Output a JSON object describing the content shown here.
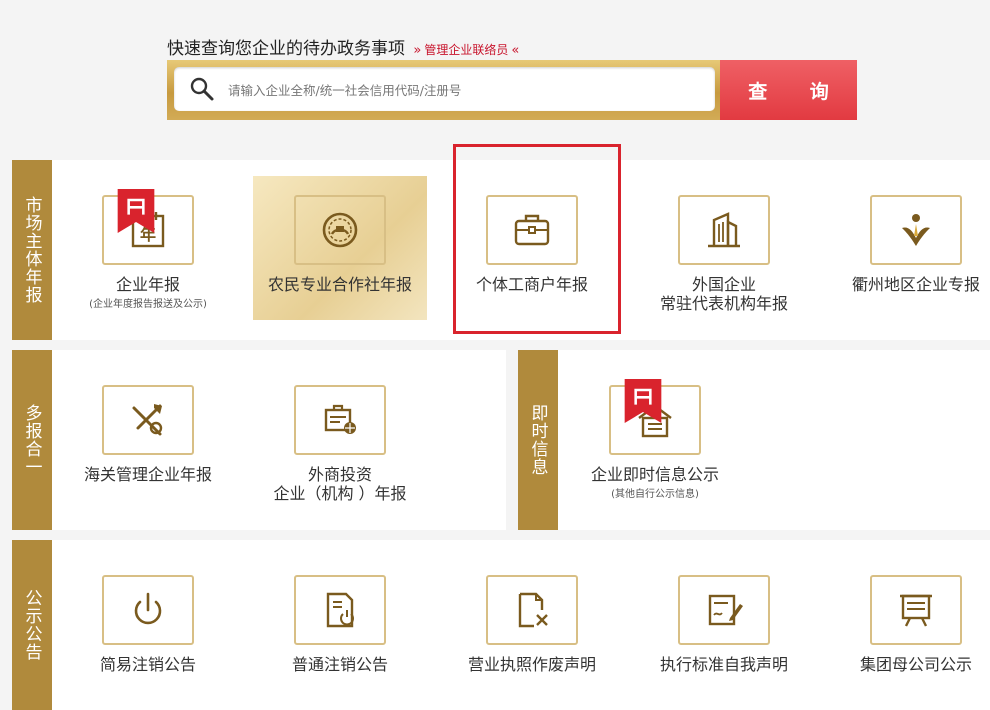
{
  "search": {
    "title": "快速查询您企业的待办政务事项",
    "liaison_link": "管理企业联络员",
    "left_arrows": "»",
    "right_arrows": "«",
    "placeholder": "请输入企业全称/统一社会信用代码/注册号",
    "button_label": "查 询"
  },
  "sections": {
    "market": {
      "label": "市场主体年报",
      "items": [
        {
          "label": "企业年报",
          "sub": "(企业年度报告报送及公示)",
          "icon": "calendar-year-icon"
        },
        {
          "label": "农民专业合作社年报",
          "icon": "cooperative-emblem-icon"
        },
        {
          "label": "个体工商户年报",
          "icon": "briefcase-icon"
        },
        {
          "label": "外国企业",
          "label2": "常驻代表机构年报",
          "icon": "building-icon"
        },
        {
          "label": "衢州地区企业专报",
          "icon": "quzhou-logo-icon"
        }
      ]
    },
    "multi": {
      "label": "多报合一",
      "items": [
        {
          "label": "海关管理企业年报",
          "icon": "customs-emblem-icon"
        },
        {
          "label": "外商投资",
          "label2": "企业（机构 ）年报",
          "icon": "foreign-investment-icon"
        }
      ]
    },
    "instant": {
      "label": "即时信息",
      "items": [
        {
          "label": "企业即时信息公示",
          "sub": "(其他自行公示信息)",
          "icon": "home-notice-icon"
        }
      ]
    },
    "notice": {
      "label": "公示公告",
      "items": [
        {
          "label": "简易注销公告",
          "icon": "power-icon"
        },
        {
          "label": "普通注销公告",
          "icon": "document-power-icon"
        },
        {
          "label": "营业执照作废声明",
          "icon": "document-cancel-icon"
        },
        {
          "label": "执行标准自我声明",
          "icon": "signature-form-icon"
        },
        {
          "label": "集团母公司公示",
          "icon": "easel-board-icon"
        }
      ]
    }
  },
  "colors": {
    "gold": "#b08a3c",
    "icon_border": "#d8bf85",
    "accent_red": "#e23a41",
    "highlight_red": "#d9232d"
  }
}
